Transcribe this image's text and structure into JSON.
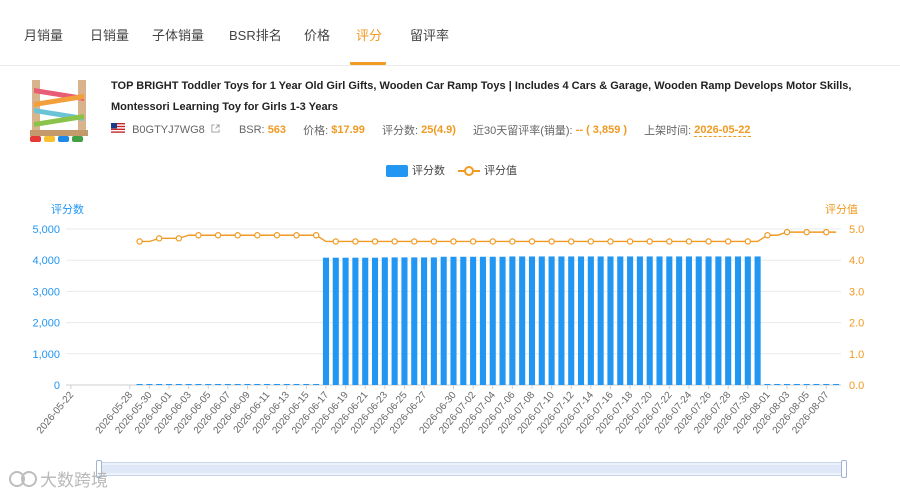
{
  "tabs": [
    {
      "label": "月销量",
      "active": false
    },
    {
      "label": "日销量",
      "active": false
    },
    {
      "label": "子体销量",
      "active": false
    },
    {
      "label": "BSR排名",
      "active": false
    },
    {
      "label": "价格",
      "active": false
    },
    {
      "label": "评分",
      "active": true
    },
    {
      "label": "留评率",
      "active": false
    }
  ],
  "product": {
    "title": "TOP BRIGHT Toddler Toys for 1 Year Old Girl Gifts, Wooden Car Ramp Toys | Includes 4 Cars & Garage, Wooden Ramp Develops Motor Skills, Montessori Learning Toy for Girls 1-3 Years",
    "flag_icon": "us-flag-icon",
    "asin": "B0GTYJ7WG8",
    "bsr_label": "BSR:",
    "bsr_value": "563",
    "price_label": "价格:",
    "price_value": "$17.99",
    "rating_label": "评分数:",
    "rating_value": "25(4.9)",
    "review_rate_label": "近30天留评率(销量):",
    "review_rate_value": "-- ( 3,859 )",
    "listed_label": "上架时间:",
    "listed_value": "2026-05-22"
  },
  "legend": {
    "bar_label": "评分数",
    "line_label": "评分值"
  },
  "colors": {
    "accent": "#f09a22",
    "bar": "#2196f3",
    "line": "#f09a22"
  },
  "watermark": "大数跨境",
  "chart_data": {
    "type": "bar",
    "title": "",
    "ylabel": "评分数",
    "y2label": "评分值",
    "ylim": [
      0,
      5000
    ],
    "y2lim": [
      0,
      5
    ],
    "yticks": [
      "0",
      "1,000",
      "2,000",
      "3,000",
      "4,000",
      "5,000"
    ],
    "y2ticks": [
      "0.0",
      "1.0",
      "2.0",
      "3.0",
      "4.0",
      "5.0"
    ],
    "grid": true,
    "legend_position": "top-center",
    "x_start": "2026-05-22",
    "x_end": "2026-08-08",
    "x_tick_labels": [
      "2026-05-22",
      "2026-05-28",
      "2026-05-30",
      "2026-06-01",
      "2026-06-03",
      "2026-06-05",
      "2026-06-07",
      "2026-06-09",
      "2026-06-11",
      "2026-06-13",
      "2026-06-15",
      "2026-06-17",
      "2026-06-19",
      "2026-06-21",
      "2026-06-23",
      "2026-06-25",
      "2026-06-27",
      "2026-06-30",
      "2026-07-02",
      "2026-07-04",
      "2026-07-06",
      "2026-07-08",
      "2026-07-10",
      "2026-07-12",
      "2026-07-14",
      "2026-07-16",
      "2026-07-18",
      "2026-07-20",
      "2026-07-22",
      "2026-07-24",
      "2026-07-26",
      "2026-07-28",
      "2026-07-30",
      "2026-08-01",
      "2026-08-03",
      "2026-08-05",
      "2026-08-07"
    ],
    "series": [
      {
        "name": "评分数",
        "type": "bar",
        "axis": "left",
        "segments": [
          {
            "from": "2026-05-29",
            "to": "2026-06-16",
            "value": 25
          },
          {
            "from": "2026-06-17",
            "to": "2026-06-22",
            "value": 4080
          },
          {
            "from": "2026-06-23",
            "to": "2026-06-28",
            "value": 4090
          },
          {
            "from": "2026-06-29",
            "to": "2026-07-05",
            "value": 4110
          },
          {
            "from": "2026-07-06",
            "to": "2026-07-31",
            "value": 4120
          },
          {
            "from": "2026-08-01",
            "to": "2026-08-08",
            "value": 25
          }
        ]
      },
      {
        "name": "评分值",
        "type": "line",
        "axis": "right",
        "segments": [
          {
            "from": "2026-05-29",
            "to": "2026-05-30",
            "value": 4.6
          },
          {
            "from": "2026-05-31",
            "to": "2026-06-02",
            "value": 4.7
          },
          {
            "from": "2026-06-03",
            "to": "2026-06-16",
            "value": 4.8
          },
          {
            "from": "2026-06-17",
            "to": "2026-07-31",
            "value": 4.6
          },
          {
            "from": "2026-08-01",
            "to": "2026-08-02",
            "value": 4.8
          },
          {
            "from": "2026-08-03",
            "to": "2026-08-08",
            "value": 4.9
          }
        ]
      }
    ]
  }
}
